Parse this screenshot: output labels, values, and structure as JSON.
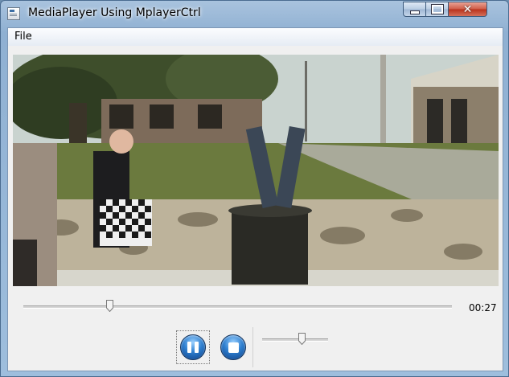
{
  "window": {
    "title": "MediaPlayer Using MplayerCtrl",
    "minimize_label": "",
    "maximize_label": "",
    "close_label": "✕"
  },
  "menu": {
    "items": [
      {
        "label": "File"
      }
    ]
  },
  "player": {
    "progress": 0.2,
    "elapsed": "00:27",
    "volume": 0.6
  },
  "controls": {
    "pause_icon": "pause-icon",
    "stop_icon": "stop-icon"
  },
  "colors": {
    "accent": "#2f7fcf",
    "close_red": "#cf5a45"
  }
}
